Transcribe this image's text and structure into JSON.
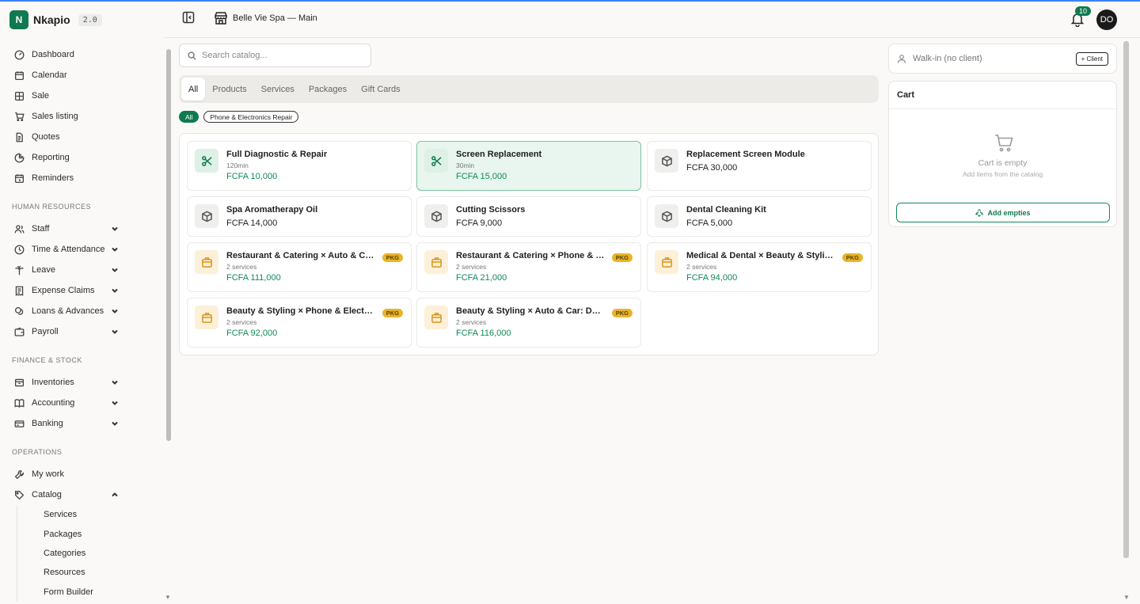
{
  "brand": {
    "initial": "N",
    "name": "Nkapio",
    "version": "2.0"
  },
  "nav": {
    "main": [
      {
        "label": "Dashboard",
        "icon": "gauge-icon"
      },
      {
        "label": "Calendar",
        "icon": "calendar-icon"
      },
      {
        "label": "Sale",
        "icon": "pos-grid-icon"
      },
      {
        "label": "Sales listing",
        "icon": "cart-icon"
      },
      {
        "label": "Quotes",
        "icon": "document-icon"
      },
      {
        "label": "Reporting",
        "icon": "pie-chart-icon"
      },
      {
        "label": "Reminders",
        "icon": "calendar-clock-icon"
      }
    ],
    "hr_title": "HUMAN RESOURCES",
    "hr": [
      {
        "label": "Staff",
        "icon": "users-icon"
      },
      {
        "label": "Time & Attendance",
        "icon": "clock-icon"
      },
      {
        "label": "Leave",
        "icon": "palm-icon"
      },
      {
        "label": "Expense Claims",
        "icon": "receipt-icon"
      },
      {
        "label": "Loans & Advances",
        "icon": "coins-icon"
      },
      {
        "label": "Payroll",
        "icon": "wallet-icon"
      }
    ],
    "finance_title": "FINANCE & STOCK",
    "finance": [
      {
        "label": "Inventories",
        "icon": "box-icon"
      },
      {
        "label": "Accounting",
        "icon": "book-icon"
      },
      {
        "label": "Banking",
        "icon": "bank-card-icon"
      }
    ],
    "ops_title": "OPERATIONS",
    "ops": [
      {
        "label": "My work",
        "icon": "wrench-icon"
      },
      {
        "label": "Catalog",
        "icon": "tag-icon"
      }
    ],
    "catalog_sub": [
      "Services",
      "Packages",
      "Categories",
      "Resources",
      "Form Builder"
    ]
  },
  "header": {
    "store": "Belle Vie Spa — Main",
    "notifications": "10",
    "avatar": "DO"
  },
  "search": {
    "placeholder": "Search catalog..."
  },
  "tabs": [
    "All",
    "Products",
    "Services",
    "Packages",
    "Gift Cards"
  ],
  "chips": [
    "All",
    "Phone & Electronics Repair"
  ],
  "items": [
    {
      "name": "Full Diagnostic & Repair",
      "sub": "120min",
      "price": "FCFA 10,000",
      "kind": "service",
      "pkg": ""
    },
    {
      "name": "Screen Replacement",
      "sub": "30min",
      "price": "FCFA 15,000",
      "kind": "service",
      "pkg": ""
    },
    {
      "name": "Replacement Screen Module",
      "sub": "",
      "price": "FCFA 30,000",
      "kind": "product",
      "pkg": ""
    },
    {
      "name": "Spa Aromatherapy Oil",
      "sub": "",
      "price": "FCFA 14,000",
      "kind": "product",
      "pkg": ""
    },
    {
      "name": "Cutting Scissors",
      "sub": "",
      "price": "FCFA 9,000",
      "kind": "product",
      "pkg": ""
    },
    {
      "name": "Dental Cleaning Kit",
      "sub": "",
      "price": "FCFA 5,000",
      "kind": "product",
      "pkg": ""
    },
    {
      "name": "Restaurant & Catering × Auto & Car: P...",
      "sub": "2 services",
      "price": "FCFA 111,000",
      "kind": "package",
      "pkg": "PKG"
    },
    {
      "name": "Restaurant & Catering × Phone & Elec...",
      "sub": "2 services",
      "price": "FCFA 21,000",
      "kind": "package",
      "pkg": "PKG"
    },
    {
      "name": "Medical & Dental × Beauty & Styling: T...",
      "sub": "2 services",
      "price": "FCFA 94,000",
      "kind": "package",
      "pkg": "PKG"
    },
    {
      "name": "Beauty & Styling × Phone & Electronic...",
      "sub": "2 services",
      "price": "FCFA 92,000",
      "kind": "package",
      "pkg": "PKG"
    },
    {
      "name": "Beauty & Styling × Auto & Car: Deep F...",
      "sub": "2 services",
      "price": "FCFA 116,000",
      "kind": "package",
      "pkg": "PKG"
    }
  ],
  "client": {
    "placeholder": "Walk-in (no client)",
    "add_label": "+ Client"
  },
  "cart": {
    "title": "Cart",
    "empty": "Cart is empty",
    "hint": "Add items from the catalog",
    "empties_label": "Add empties"
  },
  "colors": {
    "brand": "#0f7a4f",
    "price": "#0f8a57",
    "pkg_badge": "#e8b42a"
  }
}
